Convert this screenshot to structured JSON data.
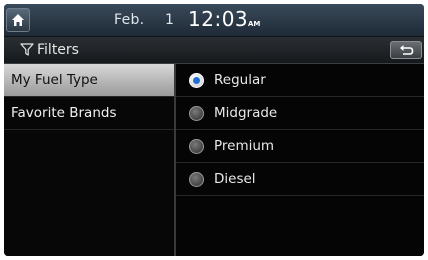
{
  "status": {
    "date": "Feb.",
    "day": "1",
    "time": "12:03",
    "ampm": "AM"
  },
  "header": {
    "title": "Filters"
  },
  "menu": {
    "items": [
      {
        "label": "My Fuel Type",
        "selected": true
      },
      {
        "label": "Favorite Brands",
        "selected": false
      }
    ]
  },
  "options": {
    "items": [
      {
        "label": "Regular",
        "checked": true
      },
      {
        "label": "Midgrade",
        "checked": false
      },
      {
        "label": "Premium",
        "checked": false
      },
      {
        "label": "Diesel",
        "checked": false
      }
    ]
  },
  "colors": {
    "accent": "#1f6fd6",
    "selected_bg": "#c8c8c8"
  }
}
